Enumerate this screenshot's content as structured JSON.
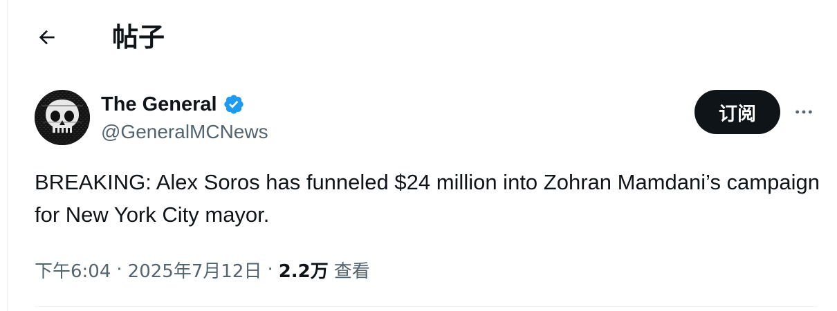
{
  "header": {
    "title": "帖子",
    "back_icon": "arrow-left-icon"
  },
  "author": {
    "display_name": "The General",
    "handle": "@GeneralMCNews",
    "verified_icon": "verified-badge-icon",
    "verified_color": "#1d9bf0",
    "avatar_icon": "skull-avatar"
  },
  "actions": {
    "subscribe_label": "订阅",
    "more_icon": "more-horizontal-icon"
  },
  "tweet": {
    "text": "BREAKING: Alex Soros has funneled $24 million into Zohran Mamdani’s campaign for New York City mayor.",
    "time": "下午6:04",
    "date": "2025年7月12日",
    "separator": "·",
    "views_count": "2.2万",
    "views_label": "查看"
  },
  "colors": {
    "text_primary": "#0f1419",
    "text_secondary": "#536471",
    "button_bg": "#0f1419",
    "divider": "#eff3f4"
  }
}
